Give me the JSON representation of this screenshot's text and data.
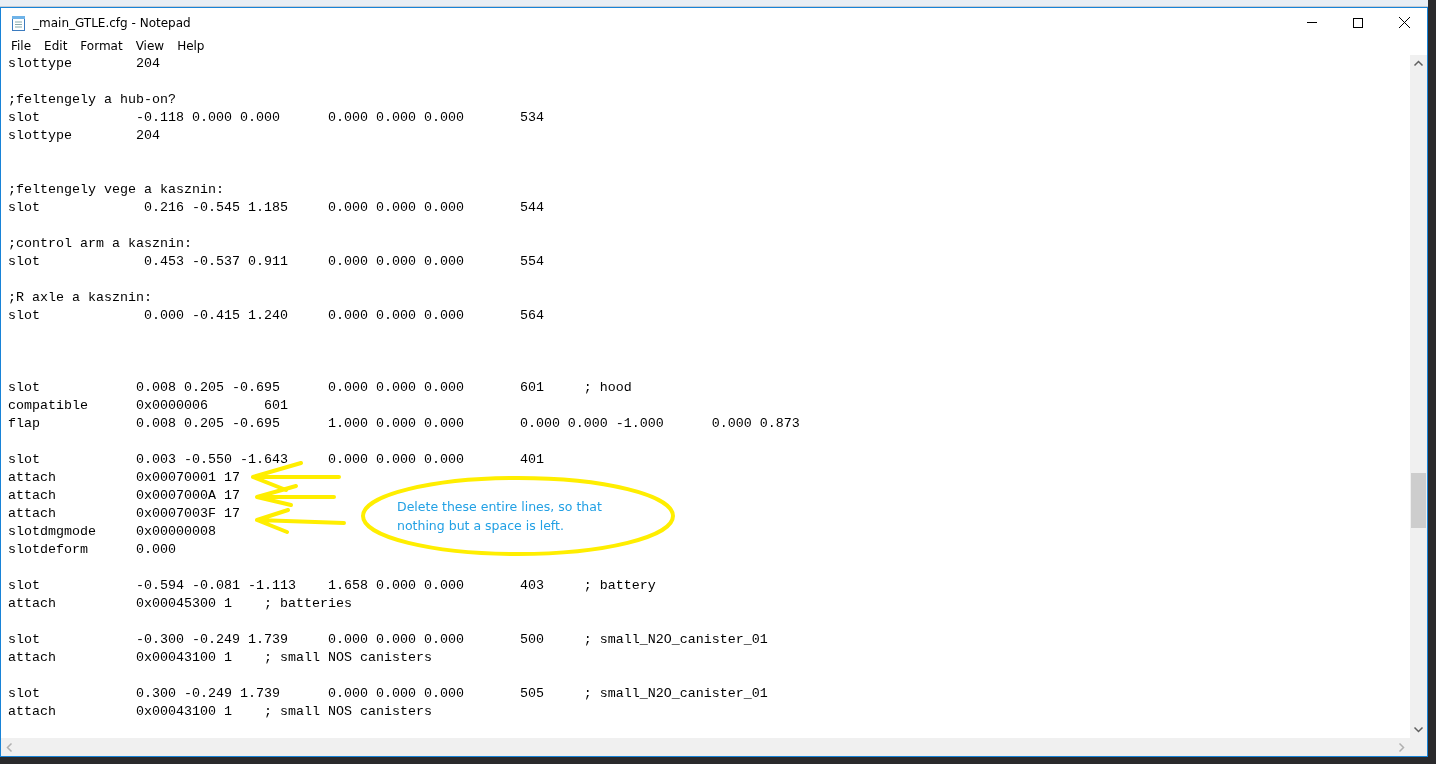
{
  "window": {
    "title": "_main_GTLE.cfg - Notepad"
  },
  "menu": [
    {
      "label": "File"
    },
    {
      "label": "Edit"
    },
    {
      "label": "Format"
    },
    {
      "label": "View"
    },
    {
      "label": "Help"
    }
  ],
  "lines": [
    {
      "kind": "text",
      "text": "slottype        204"
    },
    {
      "kind": "blank"
    },
    {
      "kind": "text",
      "text": ";feltengely a hub-on?"
    },
    {
      "kind": "text",
      "text": "slot            -0.118 0.000 0.000      0.000 0.000 0.000       534"
    },
    {
      "kind": "text",
      "text": "slottype        204"
    },
    {
      "kind": "blank"
    },
    {
      "kind": "blank"
    },
    {
      "kind": "text",
      "text": ";feltengely vege a kasznin:"
    },
    {
      "kind": "text",
      "text": "slot             0.216 -0.545 1.185     0.000 0.000 0.000       544"
    },
    {
      "kind": "blank"
    },
    {
      "kind": "text",
      "text": ";control arm a kasznin:"
    },
    {
      "kind": "text",
      "text": "slot             0.453 -0.537 0.911     0.000 0.000 0.000       554"
    },
    {
      "kind": "blank"
    },
    {
      "kind": "text",
      "text": ";R axle a kasznin:"
    },
    {
      "kind": "text",
      "text": "slot             0.000 -0.415 1.240     0.000 0.000 0.000       564"
    },
    {
      "kind": "blank"
    },
    {
      "kind": "blank"
    },
    {
      "kind": "blank"
    },
    {
      "kind": "text",
      "text": "slot            0.008 0.205 -0.695      0.000 0.000 0.000       601     ; hood"
    },
    {
      "kind": "text",
      "text": "compatible      0x0000006       601"
    },
    {
      "kind": "text",
      "text": "flap            0.008 0.205 -0.695      1.000 0.000 0.000       0.000 0.000 -1.000      0.000 0.873"
    },
    {
      "kind": "blank"
    },
    {
      "kind": "text",
      "text": "slot            0.003 -0.550 -1.643     0.000 0.000 0.000       401"
    },
    {
      "kind": "text",
      "text": "attach          0x00070001 17"
    },
    {
      "kind": "text",
      "text": "attach          0x0007000A 17"
    },
    {
      "kind": "text",
      "text": "attach          0x0007003F 17"
    },
    {
      "kind": "text",
      "text": "slotdmgmode     0x00000008"
    },
    {
      "kind": "text",
      "text": "slotdeform      0.000"
    },
    {
      "kind": "blank"
    },
    {
      "kind": "text",
      "text": "slot            -0.594 -0.081 -1.113    1.658 0.000 0.000       403     ; battery"
    },
    {
      "kind": "text",
      "text": "attach          0x00045300 1    ; batteries"
    },
    {
      "kind": "blank"
    },
    {
      "kind": "text",
      "text": "slot            -0.300 -0.249 1.739     0.000 0.000 0.000       500     ; small_N2O_canister_01"
    },
    {
      "kind": "text",
      "text": "attach          0x00043100 1    ; small NOS canisters"
    },
    {
      "kind": "blank"
    },
    {
      "kind": "text",
      "text": "slot            0.300 -0.249 1.739      0.000 0.000 0.000       505     ; small_N2O_canister_01"
    },
    {
      "kind": "text",
      "text": "attach          0x00043100 1    ; small NOS canisters"
    }
  ],
  "annotation": {
    "text": "Delete these entire lines, so that nothing but a space is left."
  }
}
